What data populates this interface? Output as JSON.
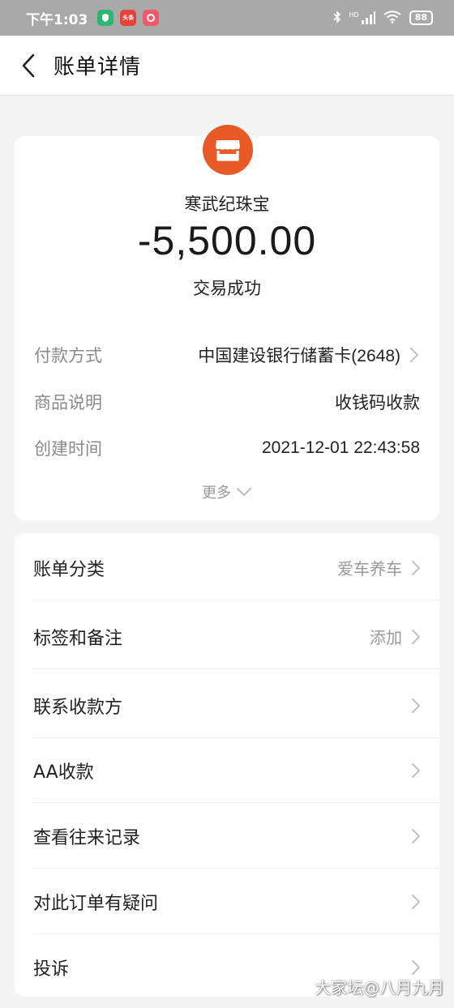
{
  "status_bar": {
    "time": "下午1:03",
    "notification_icons": [
      "shield-app-icon",
      "toutiao-app-icon",
      "pinduoduo-app-icon"
    ],
    "toutiao_label": "头条",
    "right_icons": [
      "bluetooth-icon",
      "hd-signal-icon",
      "wifi-icon"
    ],
    "hd_label": "HD",
    "battery": "88"
  },
  "nav": {
    "title": "账单详情"
  },
  "bill": {
    "merchant_name": "寒武纪珠宝",
    "amount": "-5,500.00",
    "status": "交易成功",
    "logo_color": "#e85a28",
    "details": [
      {
        "label": "付款方式",
        "value": "中国建设银行储蓄卡(2648)",
        "has_arrow": true
      },
      {
        "label": "商品说明",
        "value": "收钱码收款",
        "has_arrow": false
      },
      {
        "label": "创建时间",
        "value": "2021-12-01 22:43:58",
        "has_arrow": false
      }
    ],
    "more_label": "更多"
  },
  "actions": [
    {
      "label": "账单分类",
      "value": "爱车养车"
    },
    {
      "label": "标签和备注",
      "value": "添加"
    },
    {
      "label": "联系收款方",
      "value": ""
    },
    {
      "label": "AA收款",
      "value": ""
    },
    {
      "label": "查看往来记录",
      "value": ""
    },
    {
      "label": "对此订单有疑问",
      "value": ""
    },
    {
      "label": "投诉",
      "value": ""
    }
  ],
  "watermark": "大家坛@八月九月",
  "colors": {
    "accent": "#e85a28",
    "status_bar_bg": "#a9a9a9",
    "page_bg": "#f4f4f4"
  }
}
